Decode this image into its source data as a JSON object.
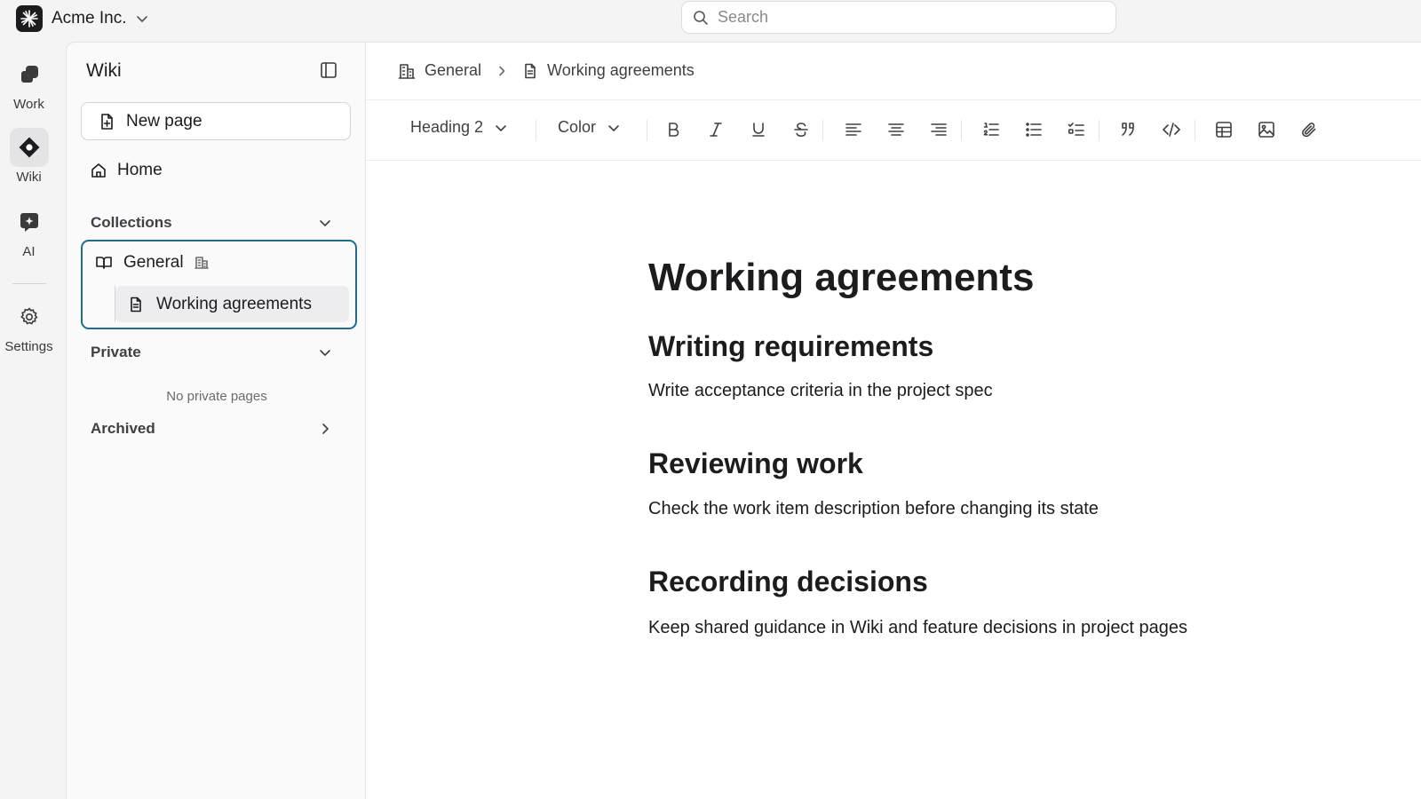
{
  "workspace": {
    "name": "Acme Inc."
  },
  "search": {
    "placeholder": "Search"
  },
  "rail": {
    "items": [
      {
        "label": "Work",
        "icon": "work-icon"
      },
      {
        "label": "Wiki",
        "icon": "wiki-icon",
        "active": true
      },
      {
        "label": "AI",
        "icon": "ai-icon"
      },
      {
        "label": "Settings",
        "icon": "gear-icon"
      }
    ]
  },
  "sidebar": {
    "title": "Wiki",
    "new_page_label": "New page",
    "home_label": "Home",
    "collections_label": "Collections",
    "collection": {
      "name": "General",
      "page": "Working agreements"
    },
    "private_label": "Private",
    "private_empty": "No private pages",
    "archived_label": "Archived"
  },
  "breadcrumb": {
    "collection": "General",
    "page": "Working agreements"
  },
  "toolbar": {
    "heading_select": "Heading 2",
    "color_select": "Color",
    "buttons": [
      "bold",
      "italic",
      "underline",
      "strikethrough",
      "align-left",
      "align-center",
      "align-right",
      "ordered-list",
      "bullet-list",
      "task-list",
      "quote",
      "code",
      "table",
      "image",
      "attachment"
    ]
  },
  "document": {
    "title": "Working agreements",
    "sections": [
      {
        "heading": "Writing requirements",
        "body": "Write acceptance criteria in the project spec"
      },
      {
        "heading": "Reviewing work",
        "body": "Check the work item description before changing its state"
      },
      {
        "heading": "Recording decisions",
        "body": "Keep shared guidance in Wiki and feature decisions in project pages"
      }
    ]
  },
  "colors": {
    "selection_border": "#1f6c8f",
    "accent_text": "#1c1c1e"
  }
}
